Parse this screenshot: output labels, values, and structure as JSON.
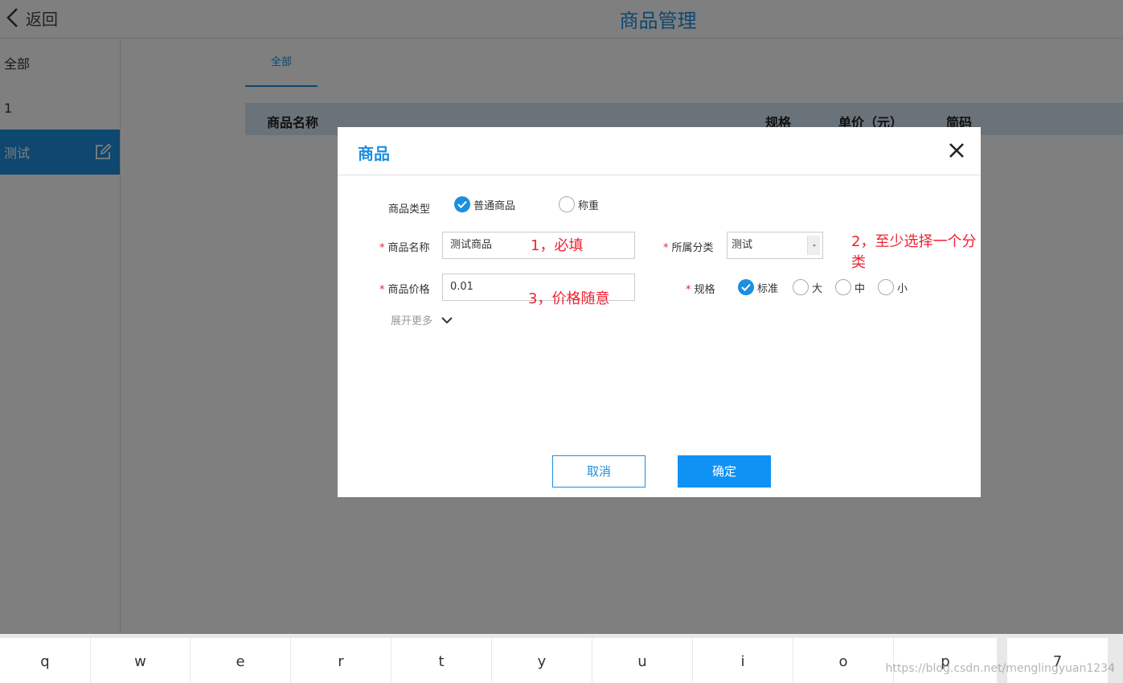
{
  "header": {
    "back_label": "返回",
    "title": "商品管理"
  },
  "sidebar": {
    "items": [
      {
        "label": "全部"
      },
      {
        "label": "1"
      },
      {
        "label": "测试"
      }
    ]
  },
  "tabs": [
    {
      "label": "全部"
    }
  ],
  "table": {
    "columns": [
      "商品名称",
      "规格",
      "单价（元）",
      "简码"
    ]
  },
  "modal": {
    "title": "商品",
    "type_label": "商品类型",
    "type_options": [
      {
        "label": "普通商品",
        "checked": true
      },
      {
        "label": "称重",
        "checked": false
      }
    ],
    "name_label": "商品名称",
    "name_value": "测试商品",
    "category_label": "所属分类",
    "category_value": "测试",
    "price_label": "商品价格",
    "price_value": "0.01",
    "spec_label": "规格",
    "spec_options": [
      {
        "label": "标准",
        "checked": true
      },
      {
        "label": "大",
        "checked": false
      },
      {
        "label": "中",
        "checked": false
      },
      {
        "label": "小",
        "checked": false
      }
    ],
    "expand_label": "展开更多",
    "cancel_label": "取消",
    "confirm_label": "确定"
  },
  "annotations": [
    "1，必填",
    "2，至少选择一个分类",
    "3，价格随意"
  ],
  "keyboard": {
    "keys": [
      "q",
      "w",
      "e",
      "r",
      "t",
      "y",
      "u",
      "i",
      "o",
      "p",
      "7"
    ]
  },
  "watermark": "https://blog.csdn.net/menglingyuan1234",
  "colors": {
    "accent": "#1c8fe0",
    "required": "#e23333",
    "primary_button": "#1092f5"
  }
}
